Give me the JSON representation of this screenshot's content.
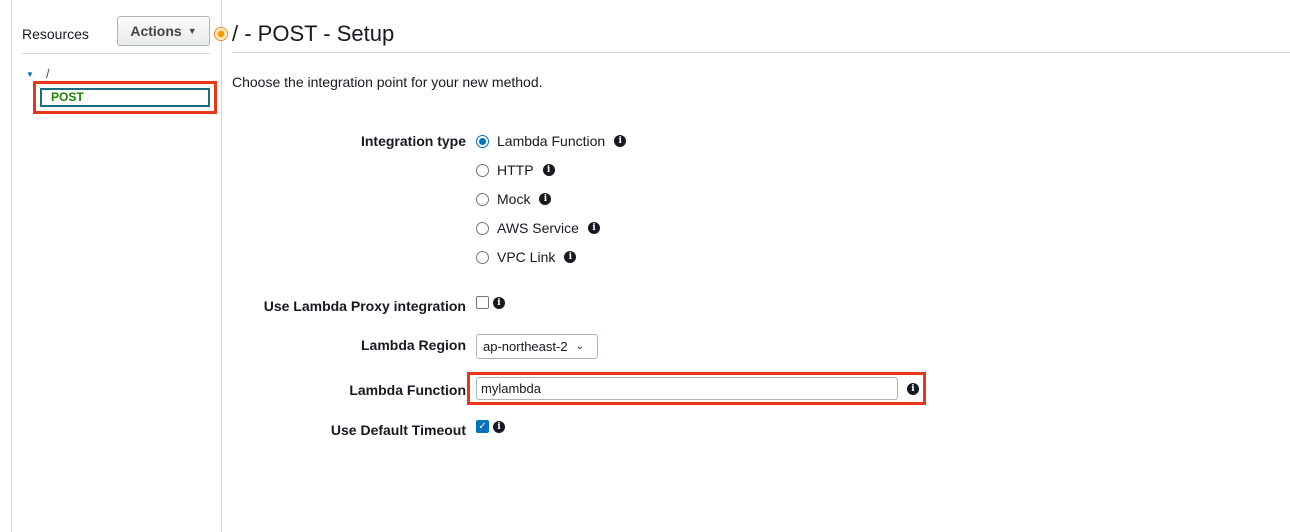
{
  "sidebar": {
    "resources_label": "Resources",
    "actions_label": "Actions",
    "tree_root": "/",
    "selected_method": "POST"
  },
  "page": {
    "title": "/ - POST - Setup",
    "intro": "Choose the integration point for your new method."
  },
  "form": {
    "integration_type_label": "Integration type",
    "integration_options": [
      {
        "label": "Lambda Function",
        "selected": true
      },
      {
        "label": "HTTP",
        "selected": false
      },
      {
        "label": "Mock",
        "selected": false
      },
      {
        "label": "AWS Service",
        "selected": false
      },
      {
        "label": "VPC Link",
        "selected": false
      }
    ],
    "proxy_label": "Use Lambda Proxy integration",
    "proxy_checked": false,
    "region_label": "Lambda Region",
    "region_value": "ap-northeast-2",
    "function_label": "Lambda Function",
    "function_value": "mylambda",
    "timeout_label": "Use Default Timeout",
    "timeout_checked": true
  },
  "colors": {
    "highlight": "#e8361a",
    "accent": "#0073bb",
    "post_text": "#1d8102"
  }
}
